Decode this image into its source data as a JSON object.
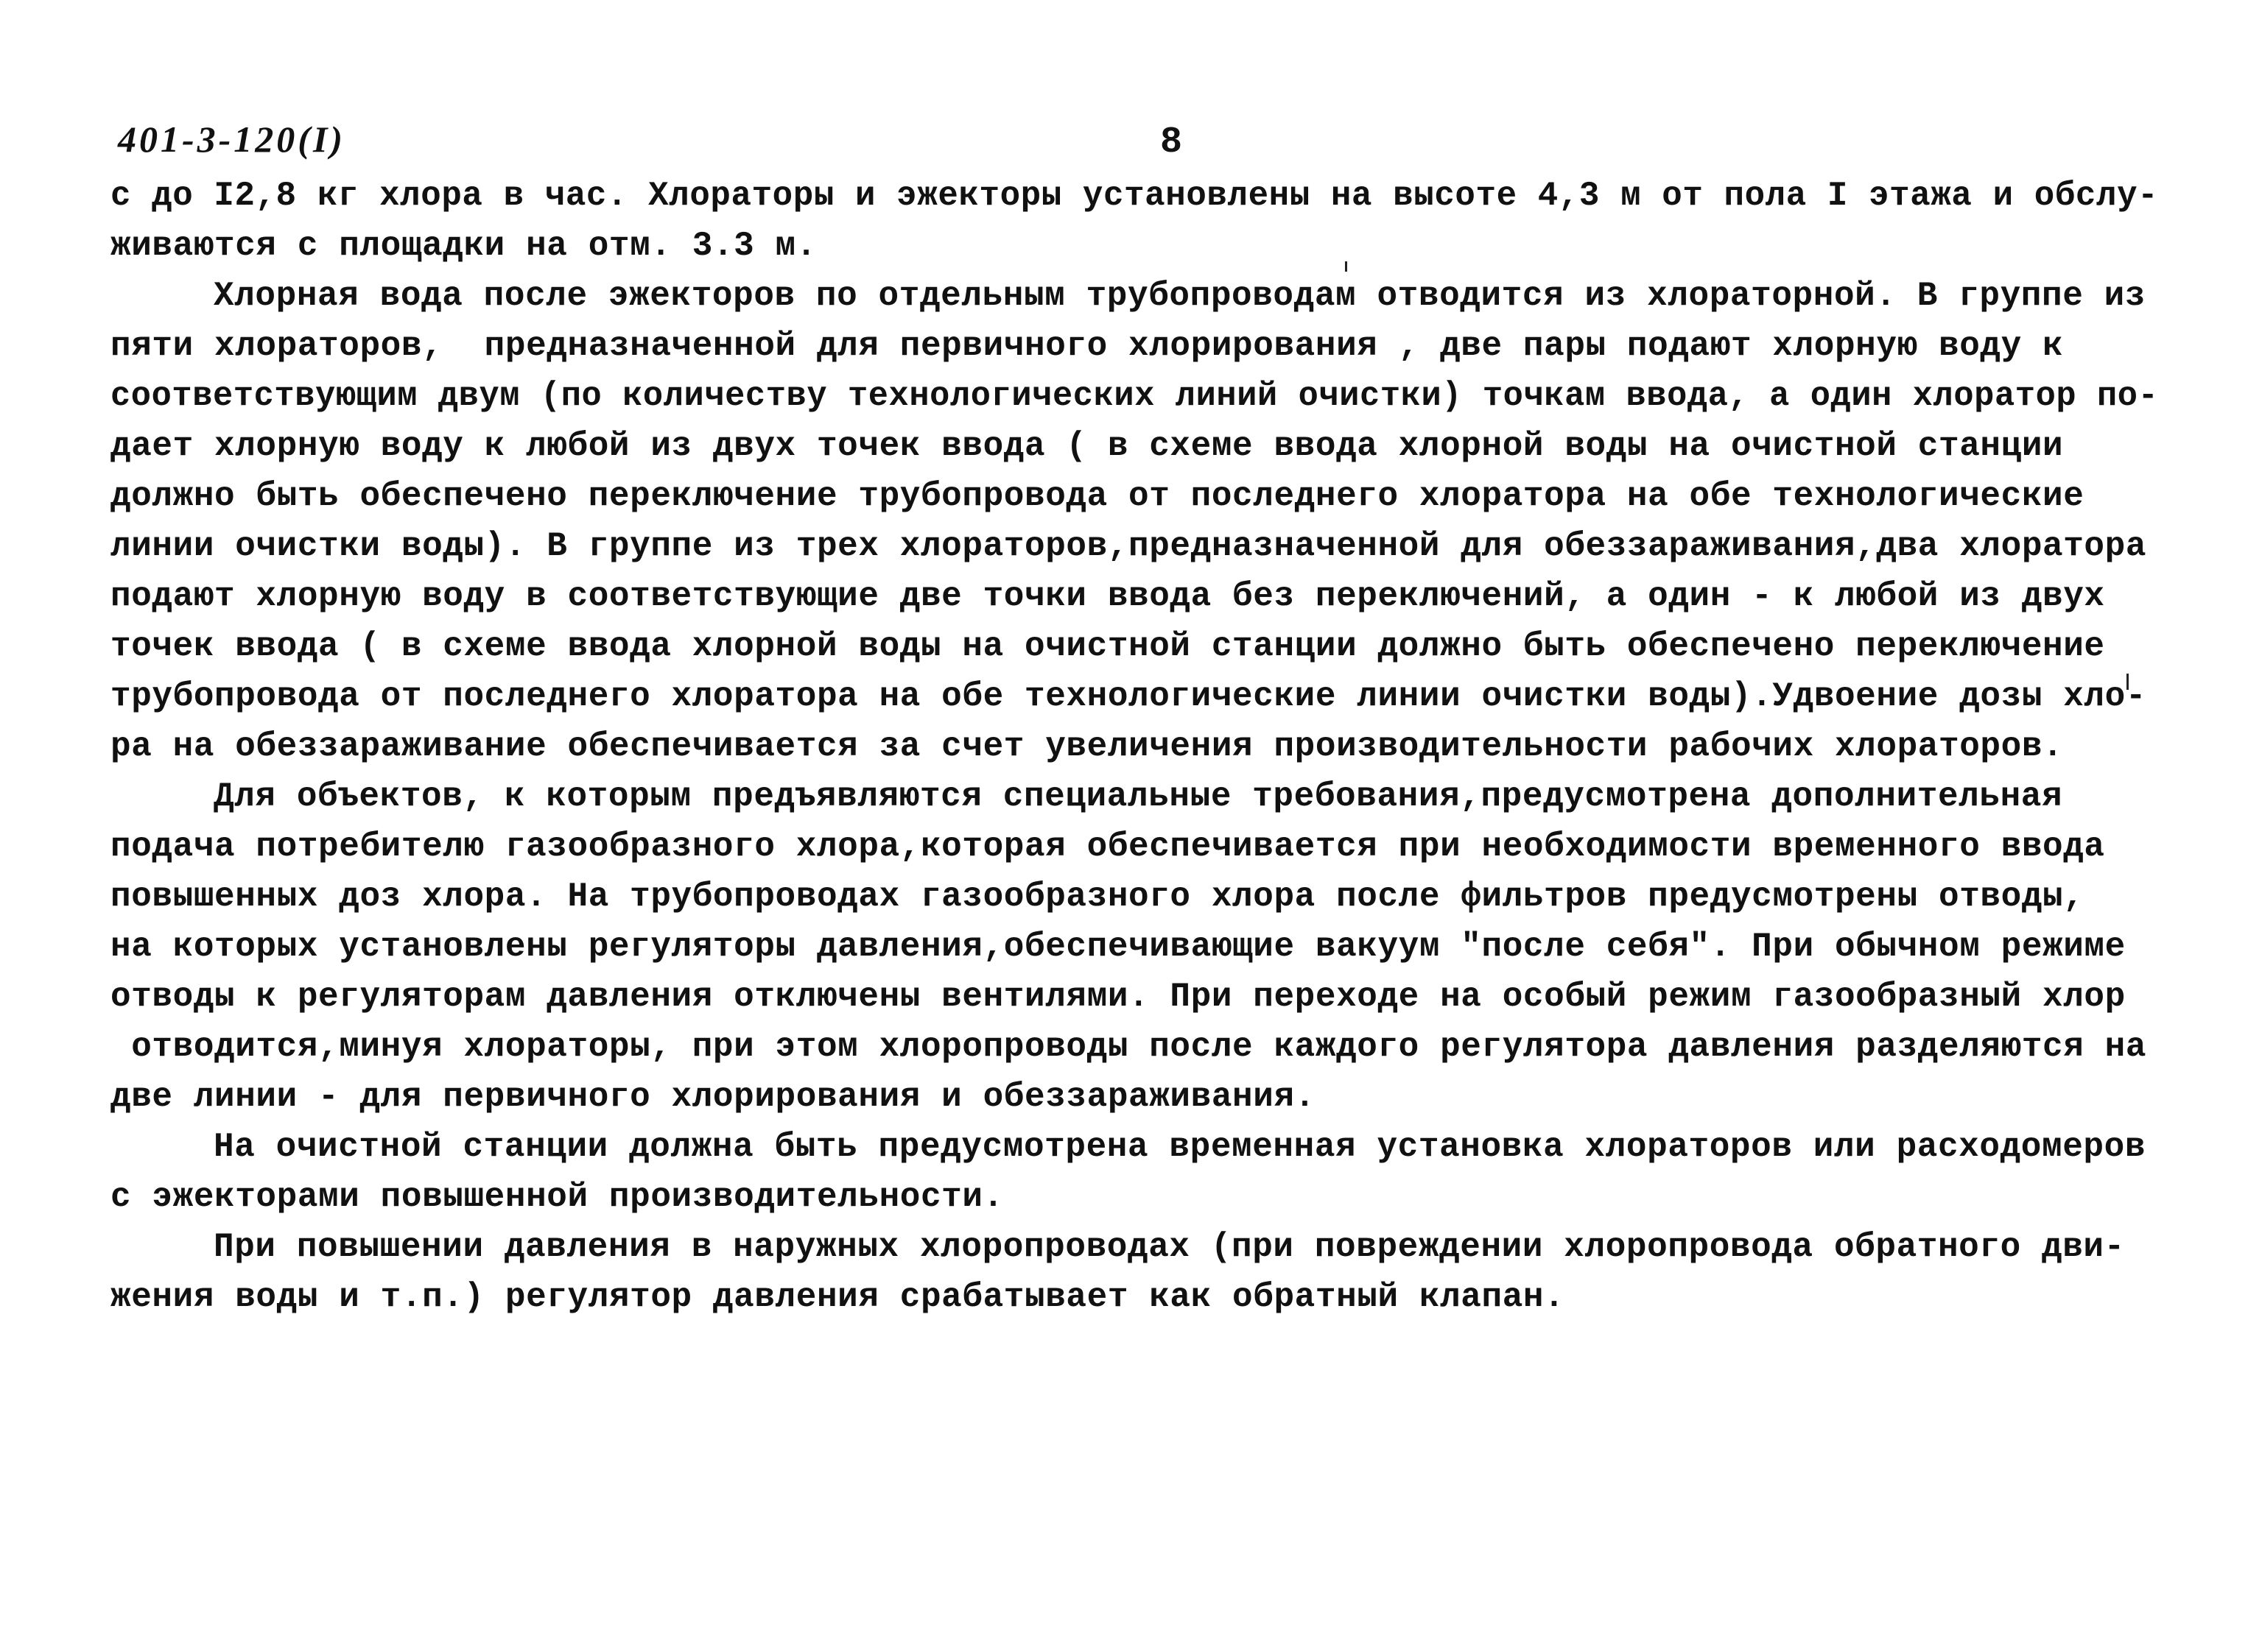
{
  "document": {
    "code": "401-3-120(I)",
    "page_number": "8",
    "lines": [
      {
        "text": "с до I2,8 кг хлора в час. Хлораторы и эжекторы установлены на высоте 4,3 м от пола I этажа и обслу-",
        "indent": false
      },
      {
        "text": "живаются с площадки на отм. 3.3 м.",
        "indent": false
      },
      {
        "text": "Хлорная вода после эжекторов по отдельным трубопроводам отводится из хлораторной. В группе из",
        "indent": true
      },
      {
        "text": "пяти хлораторов,  предназначенной для первичного хлорирования , две пары подают хлорную воду к",
        "indent": false
      },
      {
        "text": "соответствующим двум (по количеству технологических линий очистки) точкам ввода, а один хлоратор по-",
        "indent": false
      },
      {
        "text": "дает хлорную воду к любой из двух точек ввода ( в схеме ввода хлорной воды на очистной станции",
        "indent": false
      },
      {
        "text": "должно быть обеспечено переключение трубопровода от последнего хлоратора на обе технологические",
        "indent": false
      },
      {
        "text": "линии очистки воды). В группе из трех хлораторов,предназначенной для обеззараживания,два хлоратора",
        "indent": false
      },
      {
        "text": "подают хлорную воду в соответствующие две точки ввода без переключений, а один - к любой из двух",
        "indent": false
      },
      {
        "text": "точек ввода ( в схеме ввода хлорной воды на очистной станции должно быть обеспечено переключение",
        "indent": false
      },
      {
        "text": "трубопровода от последнего хлоратора на обе технологические линии очистки воды).Удвоение дозы хло-",
        "indent": false
      },
      {
        "text": "ра на обеззараживание обеспечивается за счет увеличения производительности рабочих хлораторов.",
        "indent": false
      },
      {
        "text": "Для объектов, к которым предъявляются специальные требования,предусмотрена дополнительная",
        "indent": true
      },
      {
        "text": "подача потребителю газообразного хлора,которая обеспечивается при необходимости временного ввода",
        "indent": false
      },
      {
        "text": "повышенных доз хлора. На трубопроводах газообразного хлора после фильтров предусмотрены отводы,",
        "indent": false
      },
      {
        "text": "на которых установлены регуляторы давления,обеспечивающие вакуум \"после себя\". При обычном режиме",
        "indent": false
      },
      {
        "text": "отводы к регуляторам давления отключены вентилями. При переходе на особый режим газообразный хлор",
        "indent": false
      },
      {
        "text": " отводится,минуя хлораторы, при этом хлоропроводы после каждого регулятора давления разделяются на",
        "indent": false
      },
      {
        "text": "две линии - для первичного хлорирования и обеззараживания.",
        "indent": false
      },
      {
        "text": "На очистной станции должна быть предусмотрена временная установка хлораторов или расходомеров",
        "indent": true
      },
      {
        "text": "с эжекторами повышенной производительности.",
        "indent": false
      },
      {
        "text": "При повышении давления в наружных хлоропроводах (при повреждении хлоропровода обратного дви-",
        "indent": true
      },
      {
        "text": "жения воды и т.п.) регулятор давления срабатывает как обратный клапан.",
        "indent": false
      }
    ]
  }
}
